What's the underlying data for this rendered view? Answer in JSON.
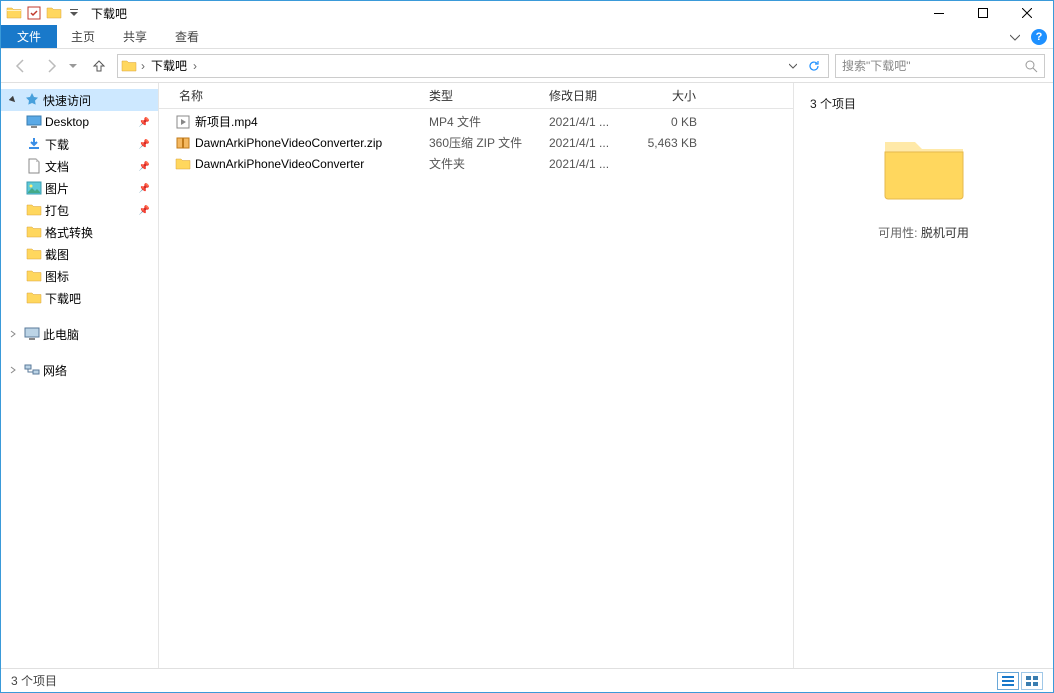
{
  "window": {
    "title": "下载吧"
  },
  "ribbon": {
    "file": "文件",
    "home": "主页",
    "share": "共享",
    "view": "查看"
  },
  "address": {
    "segment": "下载吧"
  },
  "search": {
    "placeholder": "搜索\"下载吧\""
  },
  "nav": {
    "quickaccess": "快速访问",
    "desktop": "Desktop",
    "downloads": "下载",
    "documents": "文档",
    "pictures": "图片",
    "pack": "打包",
    "format": "格式转换",
    "screenshot": "截图",
    "icon": "图标",
    "xiazaiba": "下载吧",
    "thispc": "此电脑",
    "network": "网络"
  },
  "columns": {
    "name": "名称",
    "type": "类型",
    "date": "修改日期",
    "size": "大小"
  },
  "files": [
    {
      "name": "新项目.mp4",
      "type": "MP4 文件",
      "date": "2021/4/1 ...",
      "size": "0 KB",
      "icon": "video"
    },
    {
      "name": "DawnArkiPhoneVideoConverter.zip",
      "type": "360压缩 ZIP 文件",
      "date": "2021/4/1 ...",
      "size": "5,463 KB",
      "icon": "zip"
    },
    {
      "name": "DawnArkiPhoneVideoConverter",
      "type": "文件夹",
      "date": "2021/4/1 ...",
      "size": "",
      "icon": "folder"
    }
  ],
  "preview": {
    "count": "3 个项目",
    "avail_label": "可用性:",
    "avail_value": "脱机可用"
  },
  "status": {
    "text": "3 个项目"
  }
}
